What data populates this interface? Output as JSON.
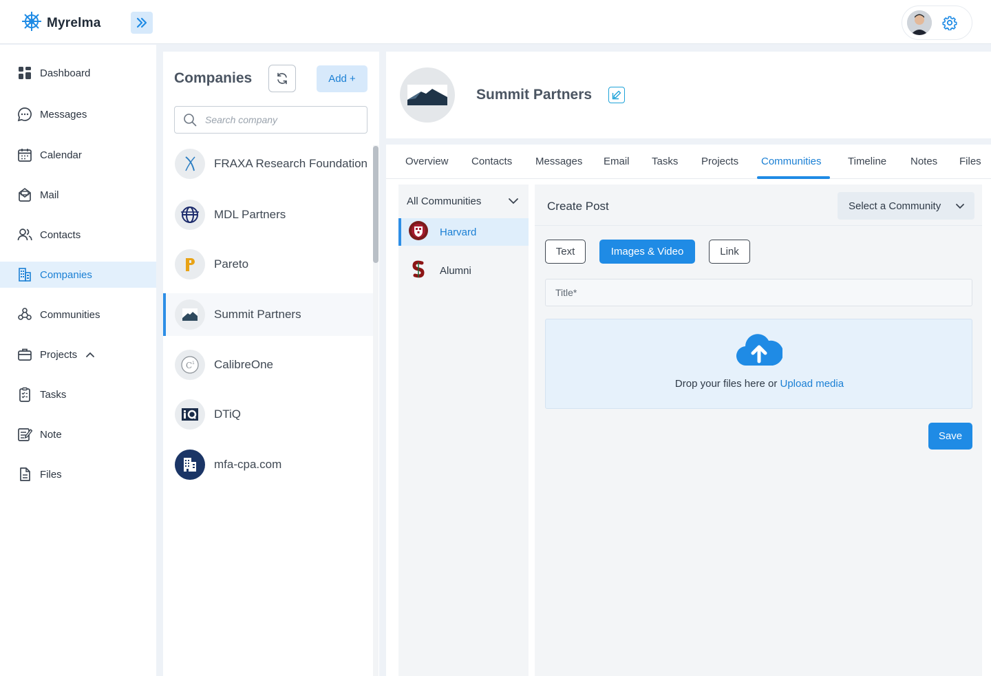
{
  "app": {
    "name": "Myrelma"
  },
  "sidebar": {
    "items": [
      {
        "label": "Dashboard",
        "icon": "dashboard-icon"
      },
      {
        "label": "Messages",
        "icon": "chat-bubble-icon"
      },
      {
        "label": "Calendar",
        "icon": "calendar-icon"
      },
      {
        "label": "Mail",
        "icon": "mail-icon"
      },
      {
        "label": "Contacts",
        "icon": "contacts-icon"
      },
      {
        "label": "Companies",
        "icon": "companies-icon",
        "active": true
      },
      {
        "label": "Communities",
        "icon": "communities-icon"
      },
      {
        "label": "Projects",
        "icon": "briefcase-icon",
        "expanded": true
      },
      {
        "label": "Tasks",
        "icon": "clipboard-icon"
      },
      {
        "label": "Note",
        "icon": "note-icon"
      },
      {
        "label": "Files",
        "icon": "file-icon"
      }
    ]
  },
  "companies": {
    "title": "Companies",
    "add_label": "Add +",
    "search_placeholder": "Search company",
    "list": [
      {
        "name": "FRAXA Research Foundation"
      },
      {
        "name": "MDL Partners"
      },
      {
        "name": "Pareto"
      },
      {
        "name": "Summit Partners",
        "selected": true
      },
      {
        "name": "CalibreOne"
      },
      {
        "name": "DTiQ"
      },
      {
        "name": "mfa-cpa.com"
      }
    ]
  },
  "profile": {
    "name": "Summit Partners"
  },
  "tabs": [
    "Overview",
    "Contacts",
    "Messages",
    "Email",
    "Tasks",
    "Projects",
    "Communities",
    "Timeline",
    "Notes",
    "Files"
  ],
  "active_tab": "Communities",
  "communities": {
    "filter_label": "All Communities",
    "items": [
      {
        "label": "Harvard",
        "active": true
      },
      {
        "label": "Alumni"
      }
    ]
  },
  "post": {
    "title": "Create Post",
    "select_label": "Select a Community",
    "types": [
      "Text",
      "Images & Video",
      "Link"
    ],
    "active_type": "Images & Video",
    "title_placeholder": "Title*",
    "drop_text": "Drop your files here or ",
    "upload_link": "Upload media",
    "save_label": "Save"
  },
  "colors": {
    "accent": "#1f8be5",
    "active_bg": "#e3f0fc",
    "sidebar_active_text": "#1a7fd4"
  }
}
